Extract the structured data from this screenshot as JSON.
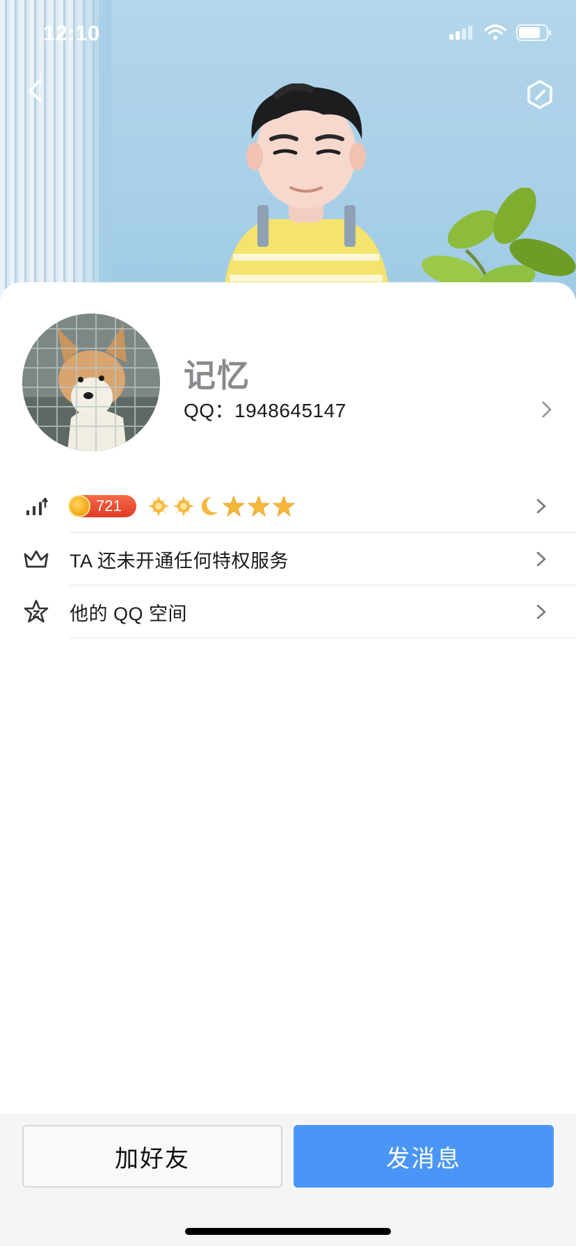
{
  "status_bar": {
    "time": "12:10",
    "signal_icon": "cellular-signal-icon",
    "wifi_icon": "wifi-icon",
    "battery_icon": "battery-icon"
  },
  "nav": {
    "back_icon": "chevron-left-icon",
    "settings_icon": "hexagon-settings-icon"
  },
  "profile": {
    "nickname": "记忆",
    "qq_label": "QQ：1948645147",
    "avatar": "corgi-dog-avatar"
  },
  "rows": [
    {
      "icon": "level-chart-icon",
      "level_value": "721",
      "level_icons": [
        "sun-icon",
        "sun-icon",
        "moon-icon",
        "star-icon",
        "star-icon",
        "star-icon"
      ]
    },
    {
      "icon": "crown-icon",
      "label": "TA 还未开通任何特权服务"
    },
    {
      "icon": "star-outline-icon",
      "label": "他的 QQ 空间"
    }
  ],
  "bottom": {
    "add_friend_label": "加好友",
    "send_message_label": "发消息"
  },
  "colors": {
    "primary_button": "#4a96f6",
    "level_badge": "#e03b27",
    "header_sky": "#a9d0e8"
  }
}
